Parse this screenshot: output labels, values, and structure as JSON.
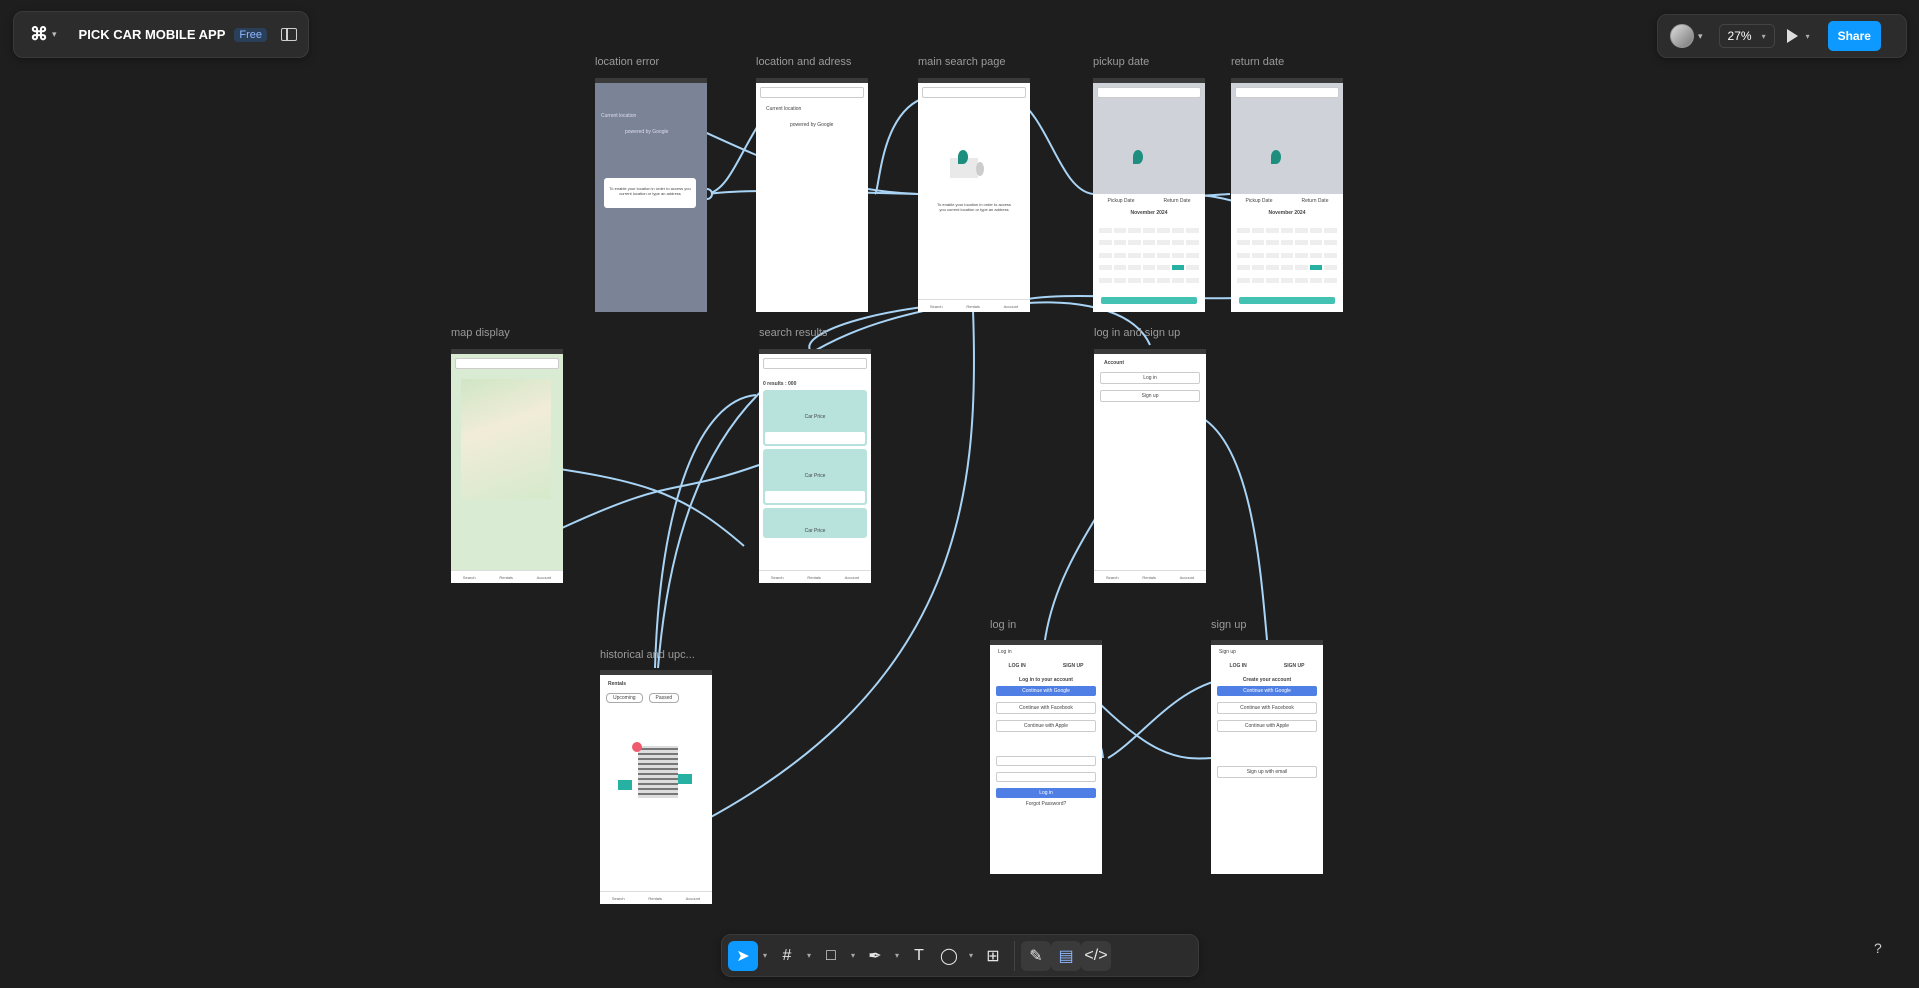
{
  "app": {
    "file_name": "PICK CAR MOBILE APP",
    "plan_badge": "Free",
    "logo_icon": "figma-logo",
    "zoom": "27%",
    "share_label": "Share",
    "help": "?"
  },
  "frames": {
    "location_error": "location error",
    "location_address": "location and adress",
    "main_search": "main search page",
    "pickup_date": "pickup date",
    "return_date": "return date",
    "map_display": "map display",
    "search_results": "search results",
    "login_signup": "log in and sign up",
    "log_in": "log in",
    "sign_up": "sign up",
    "historical": "historical and upc..."
  },
  "screen_text": {
    "current_location": "Current location",
    "powered": "powered by Google",
    "enable_location": "To enable your location in order to access you current location or type an address",
    "month": "November 2024",
    "pickup_date": "Pickup Date",
    "return_date": "Return Date",
    "results_count": "0 results : 000",
    "car_price": "Car Price",
    "account": "Account",
    "log_in": "Log in",
    "sign_up": "Sign up",
    "login_tab": "LOG IN",
    "signup_tab": "SIGN UP",
    "log_in_title": "Log in to your account",
    "create_title": "Create your account",
    "google": "Continue with Google",
    "facebook": "Continue with Facebook",
    "apple": "Continue with Apple",
    "email_signup": "Sign up with email",
    "forgot": "Forgot Password?",
    "rentals": "Rentals",
    "upcoming": "Upcoming",
    "passed": "Passed",
    "nav_search": "Search",
    "nav_rentals": "Rentals",
    "nav_account": "Account"
  },
  "toolbar": {
    "tools": [
      "move-tool-icon",
      "frame-tool-icon",
      "rectangle-tool-icon",
      "pen-tool-icon",
      "text-tool-icon",
      "comment-tool-icon",
      "actions-tool-icon"
    ],
    "modes": [
      "draw-mode-icon",
      "design-mode-icon",
      "dev-mode-icon"
    ],
    "text_glyph": "T"
  },
  "colors": {
    "canvas": "#1e1e1e",
    "panel": "#2c2c2c",
    "accent": "#0d99ff",
    "wire": "#a9d4f5",
    "teal": "#43c1b2"
  }
}
